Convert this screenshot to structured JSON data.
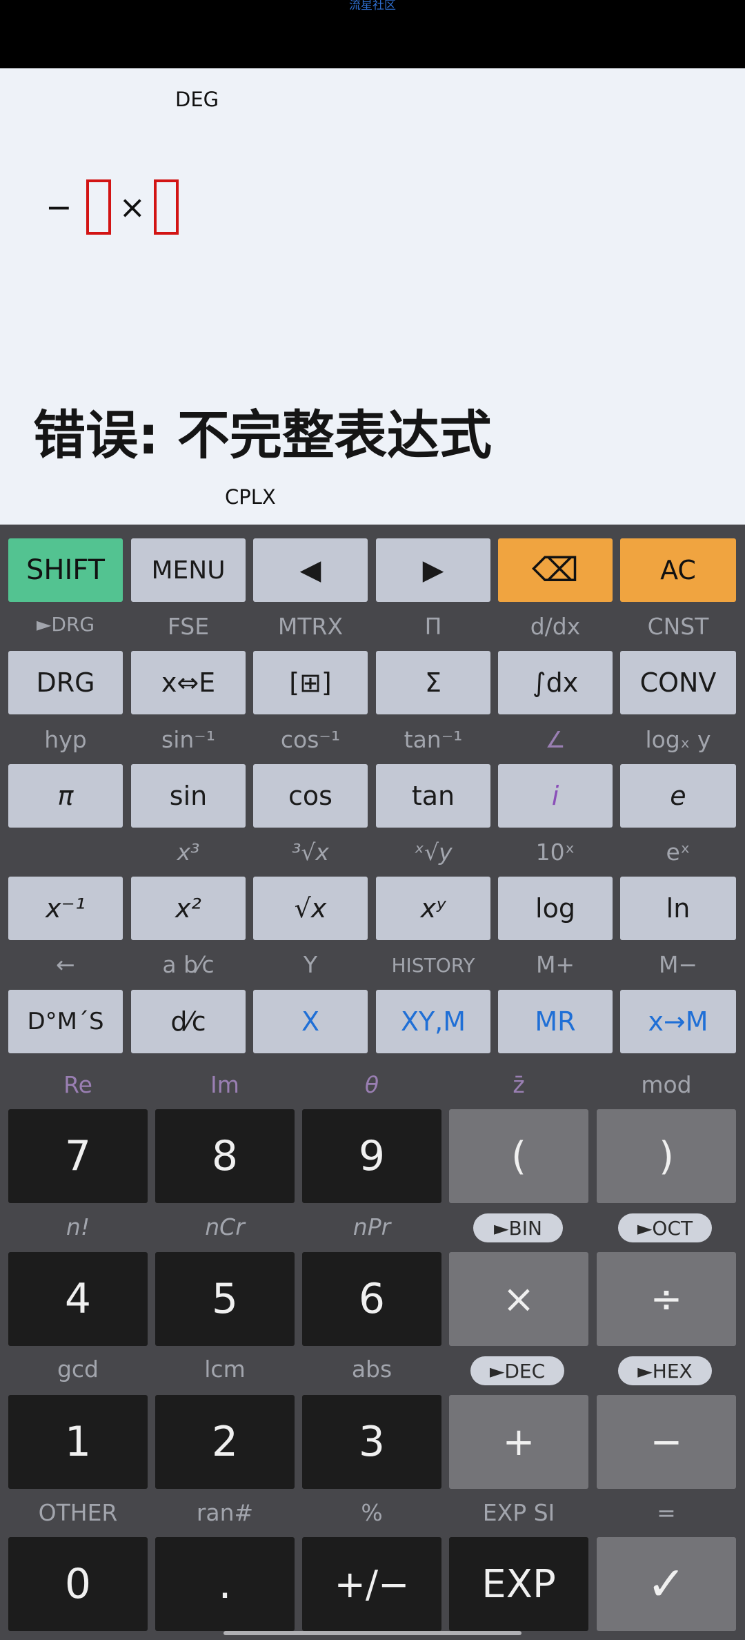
{
  "watermark": "流星社区",
  "display": {
    "mode": "DEG",
    "expression": {
      "minus": "−",
      "times": "×"
    },
    "error": "错误: 不完整表达式",
    "complex_mode": "CPLX"
  },
  "row1": {
    "shift": "SHIFT",
    "menu": "MENU",
    "left": "◀",
    "right": "▶",
    "backspace": "⌫",
    "ac": "AC"
  },
  "row2_labels": [
    "►DRG",
    "FSE",
    "MTRX",
    "Π",
    "d/dx",
    "CNST"
  ],
  "row2": [
    "DRG",
    "x⇔E",
    "[⊞]",
    "Σ",
    "∫dx",
    "CONV"
  ],
  "row3_labels": [
    "hyp",
    "sin⁻¹",
    "cos⁻¹",
    "tan⁻¹",
    "∠",
    "logₓ y"
  ],
  "row3": [
    "π",
    "sin",
    "cos",
    "tan",
    "i",
    "e"
  ],
  "row4_labels": [
    "",
    "x³",
    "³√x",
    "ˣ√y",
    "10ˣ",
    "eˣ"
  ],
  "row4": [
    "x⁻¹",
    "x²",
    "√x",
    "xʸ",
    "log",
    "ln"
  ],
  "row5_labels": [
    "←",
    "a b⁄c",
    "Y",
    "HISTORY",
    "M+",
    "M−"
  ],
  "row5": [
    "D°M´S",
    "d⁄c",
    "X",
    "XY,M",
    "MR",
    "x→M"
  ],
  "num_row1_labels": [
    "Re",
    "Im",
    "θ",
    "z̄",
    "mod"
  ],
  "num_row1": [
    "7",
    "8",
    "9",
    "(",
    ")"
  ],
  "num_row2_labels": [
    "n!",
    "nCr",
    "nPr",
    "►BIN",
    "►OCT"
  ],
  "num_row2": [
    "4",
    "5",
    "6",
    "×",
    "÷"
  ],
  "num_row3_labels": [
    "gcd",
    "lcm",
    "abs",
    "►DEC",
    "►HEX"
  ],
  "num_row3": [
    "1",
    "2",
    "3",
    "+",
    "−"
  ],
  "num_row4_labels": [
    "OTHER",
    "ran#",
    "%",
    "EXP SI",
    "="
  ],
  "num_row4": [
    "0",
    ".",
    "+/−",
    "EXP",
    "✓"
  ]
}
